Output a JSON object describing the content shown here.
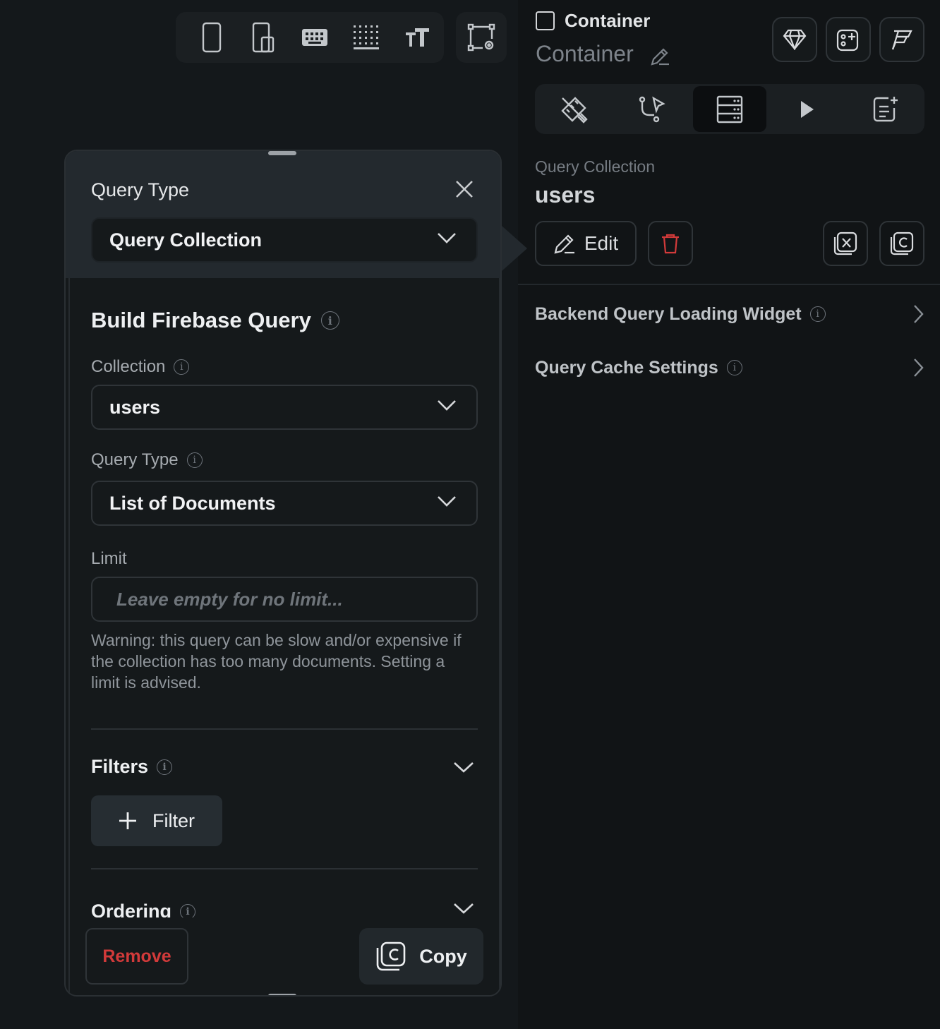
{
  "toolbar": {
    "icons": [
      "phone-icon",
      "tablet-icon",
      "keyboard-icon",
      "grid-icon",
      "text-size-icon",
      "canvas-settings-icon"
    ]
  },
  "properties": {
    "widget_type": "Container",
    "widget_name": "Container",
    "header_icons": [
      "diamond-icon",
      "add-widget-icon",
      "ai-gen-icon"
    ],
    "tabs": [
      "properties-tab",
      "actions-tab",
      "backend-query-tab",
      "animations-tab",
      "notes-tab"
    ],
    "query_collection_label": "Query Collection",
    "query_collection_value": "users",
    "edit_label": "Edit",
    "expandables": {
      "loading_widget": "Backend Query Loading Widget",
      "cache_settings": "Query Cache Settings"
    }
  },
  "popup": {
    "title": "Query Type",
    "query_type_value": "Query Collection",
    "section_title": "Build Firebase Query",
    "collection_label": "Collection",
    "collection_value": "users",
    "query_type_label": "Query Type",
    "query_type_select": "List of Documents",
    "limit_label": "Limit",
    "limit_placeholder": "Leave empty for no limit...",
    "warning": "Warning: this query can be slow and/or expensive if the collection has too many documents. Setting a limit is advised.",
    "filters_label": "Filters",
    "add_filter_label": "Filter",
    "ordering_label": "Ordering",
    "remove_label": "Remove",
    "copy_label": "Copy"
  },
  "colors": {
    "background": "#14181b",
    "panel": "#111416",
    "popup_head": "#23292e",
    "danger": "#d23a3a"
  }
}
